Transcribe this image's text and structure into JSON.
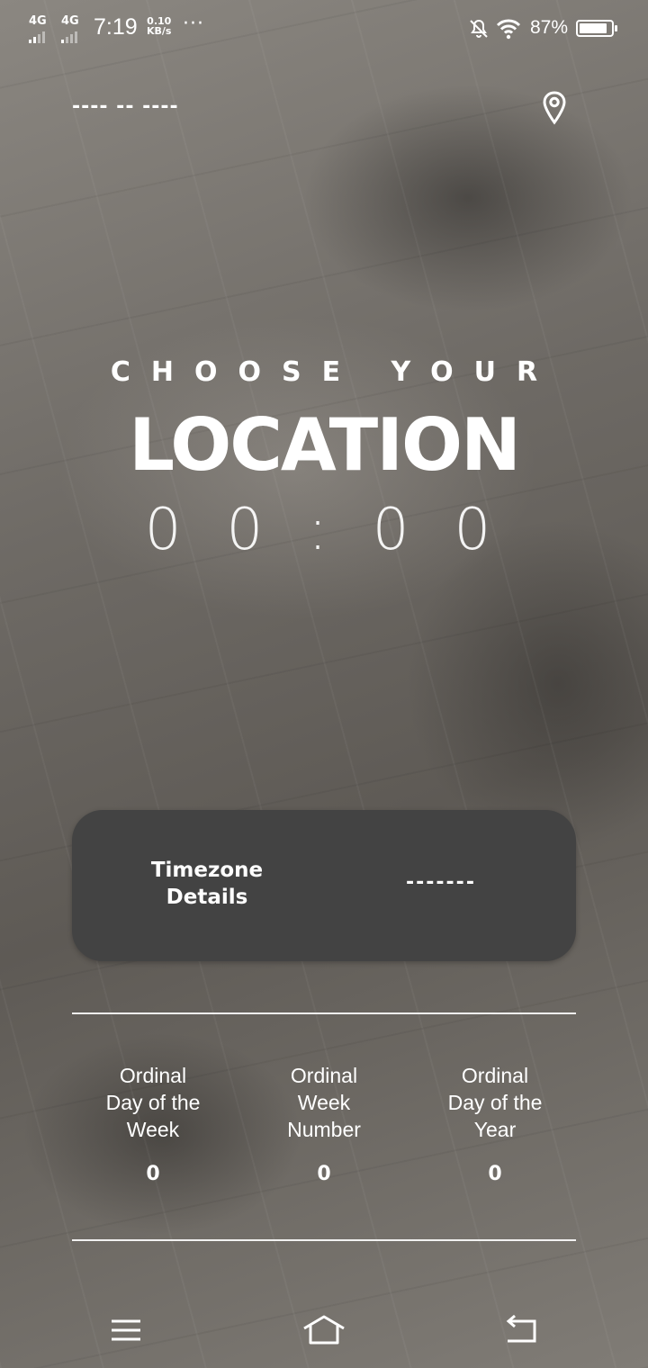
{
  "status_bar": {
    "network1": "4G",
    "network2": "4G",
    "time": "7:19",
    "speed_value": "0.10",
    "speed_unit": "KB/s",
    "more": "···",
    "battery_percent": "87%",
    "battery_level": 0.87
  },
  "header": {
    "date_placeholder": "---- -- ----",
    "location_icon": "map-pin-icon"
  },
  "hero": {
    "line1": "CHOOSE YOUR",
    "line2": "LOCATION",
    "clock_h1": "0",
    "clock_h2": "0",
    "clock_sep": ":",
    "clock_m1": "0",
    "clock_m2": "0"
  },
  "timezone_card": {
    "label_line1": "Timezone",
    "label_line2": "Details",
    "value": "-------"
  },
  "stats": [
    {
      "label_lines": [
        "Ordinal",
        "Day of the",
        "Week"
      ],
      "value": "0"
    },
    {
      "label_lines": [
        "Ordinal",
        "Week",
        "Number"
      ],
      "value": "0"
    },
    {
      "label_lines": [
        "Ordinal",
        "Day of the",
        "Year"
      ],
      "value": "0"
    }
  ],
  "nav": {
    "menu_icon": "menu-icon",
    "home_icon": "home-icon",
    "back_icon": "back-icon"
  }
}
